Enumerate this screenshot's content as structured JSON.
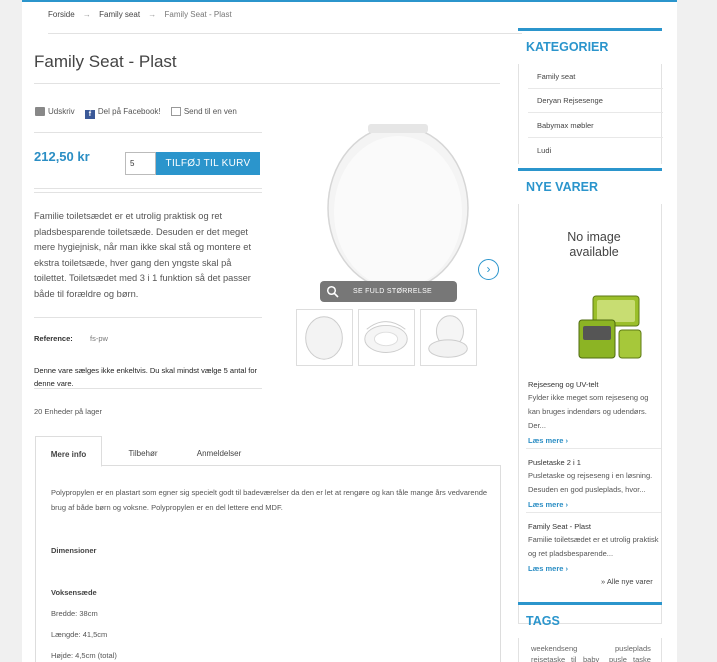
{
  "breadcrumb": {
    "home": "Forside",
    "sep": "→",
    "category": "Family seat",
    "current": "Family Seat - Plast"
  },
  "product": {
    "title": "Family Seat - Plast",
    "tools": {
      "print": "Udskriv",
      "facebook": "Del på Facebook!",
      "email": "Send til en ven"
    },
    "price": "212,50 kr",
    "quantity": "5",
    "add_to_cart": "TILFØJ TIL KURV",
    "description": "Familie toiletsædet er et utrolig praktisk og ret pladsbesparende toiletsæde. Desuden er det meget mere hygiejnisk, når man ikke skal stå og montere et ekstra toiletsæde, hver gang den yngste skal på toilettet. Toiletsædet med 3 i 1 funktion så det passer både til forældre og børn.",
    "reference_label": "Reference:",
    "reference_value": "fs-pw",
    "min_qty_note": "Denne vare sælges ikke enkeltvis. Du skal mindst vælge 5 antal for denne vare.",
    "stock": "20 Enheder på lager",
    "full_size": "SE FULD STØRRELSE"
  },
  "tabs": {
    "items": [
      "Mere info",
      "Tilbehør",
      "Anmeldelser"
    ],
    "active": "Mere info",
    "intro": "Polypropylen er en plastart som egner sig specielt godt til badeværelser da den er let at rengøre og kan tåle mange års vedvarende brug af både børn og voksne. Polypropylen er en del lettere end MDF.",
    "dimensions_label": "Dimensioner",
    "adult_label": "Voksensæde",
    "width": "Bredde: 38cm",
    "length": "Længde: 41,5cm",
    "height": "Højde: 4,5cm (total)"
  },
  "sidebar": {
    "categories_title": "KATEGORIER",
    "categories": [
      "Family seat",
      "Deryan Rejsesenge",
      "Babymax møbler",
      "Ludi"
    ],
    "new_title": "NYE VARER",
    "no_image": "No image available",
    "new_items": [
      {
        "title": "Rejseseng og UV-telt",
        "text": "Fylder ikke meget som rejseseng og kan bruges indendørs og udendørs. Der...",
        "more": "Læs mere"
      },
      {
        "title": "Pusletaske 2 i 1",
        "text": "Pusletaske og rejseseng i en løsning. Desuden en god pusleplads, hvor...",
        "more": "Læs mere"
      },
      {
        "title": "Family Seat - Plast",
        "text": "Familie toiletsædet er et utrolig praktisk og ret pladsbesparende...",
        "more": "Læs mere"
      }
    ],
    "all_new": "» Alle nye varer",
    "tags_title": "TAGS",
    "tags": [
      "weekendseng",
      "pusleplads",
      "rejsetaske",
      "til",
      "baby",
      "pusle",
      "taske"
    ]
  }
}
